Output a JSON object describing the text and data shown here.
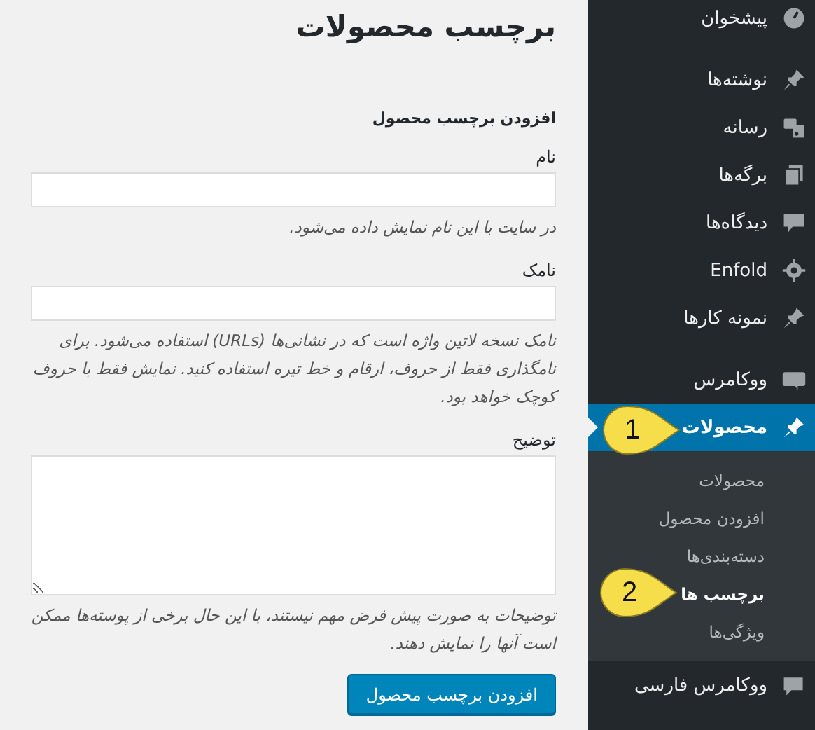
{
  "page": {
    "title": "برچسب محصولات"
  },
  "form": {
    "heading": "افزودن برچسب محصول",
    "fields": [
      {
        "kind": "text",
        "label": "نام",
        "description": "در سایت با این نام نمایش داده می‌شود."
      },
      {
        "kind": "text",
        "label": "نامک",
        "description": "نامک نسخه لاتین واژه است که در نشانی‌ها (URLs) استفاده می‌شود. برای نامگذاری فقط از حروف، ارقام و خط تیره استفاده کنید. نمایش فقط با حروف کوچک خواهد بود."
      },
      {
        "kind": "textarea",
        "label": "توضیح",
        "description": "توضیحات به صورت پیش فرض مهم نیستند، با این حال برخی از پوسته‌ها ممکن است آنها را نمایش دهند."
      }
    ],
    "submit": "افزودن برچسب محصول"
  },
  "sidebar": {
    "items": [
      {
        "label": "پیشخوان",
        "selected": false
      },
      {
        "label": "نوشته‌ها",
        "selected": false
      },
      {
        "label": "رسانه",
        "selected": false
      },
      {
        "label": "برگه‌ها",
        "selected": false
      },
      {
        "label": "دیدگاه‌ها",
        "selected": false
      },
      {
        "label": "Enfold",
        "selected": false
      },
      {
        "label": "نمونه کارها",
        "selected": false
      },
      {
        "label": "ووکامرس",
        "selected": false
      },
      {
        "label": "محصولات",
        "selected": true,
        "children": [
          {
            "label": "محصولات",
            "selected": false
          },
          {
            "label": "افزودن محصول",
            "selected": false
          },
          {
            "label": "دسته‌بندی‌ها",
            "selected": false
          },
          {
            "label": "برچسب ها",
            "selected": true
          },
          {
            "label": "ویژگی‌ها",
            "selected": false
          }
        ]
      },
      {
        "label": "ووکامرس فارسی",
        "selected": false
      }
    ]
  },
  "callouts": [
    {
      "label": "1"
    },
    {
      "label": "2"
    }
  ]
}
